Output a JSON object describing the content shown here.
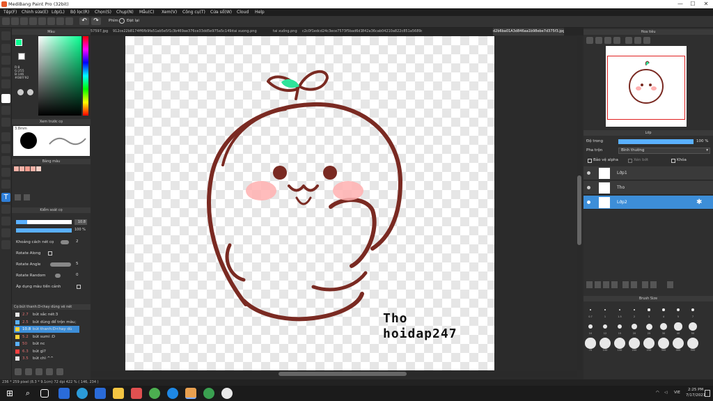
{
  "window": {
    "title": "MediBang Paint Pro (32bit)",
    "minimize": "—",
    "maximize": "☐",
    "close": "✕"
  },
  "menu": [
    "Tệp(F)",
    "Chỉnh sửa(E)",
    "Lớp(L)",
    "Bộ lọc(R)",
    "Chọn(S)",
    "Chụp(N)",
    "Mẫu(C)",
    "Xem(V)",
    "Công cụ(T)",
    "Cửa sổ(W)",
    "Cloud",
    "Help"
  ],
  "toolbar": {
    "keys_label": "Phím",
    "reset_label": "Đặt lại"
  },
  "color_panel": {
    "title": "Màu",
    "r": "R:8",
    "g": "G:255",
    "b": "B:146",
    "hex": "#08FF92"
  },
  "preview_panel": {
    "title": "Xem trước cọ",
    "size": "3.8mm"
  },
  "palette_panel": {
    "title": "Bảng màu",
    "colors": [
      "#f7b3a8",
      "#f7b3a8",
      "#f59c8e",
      "#f7b3a8",
      "#f9d0c6"
    ]
  },
  "brush_ctrl": {
    "title": "Kiểm soát cọ",
    "size_value": "10.8",
    "opacity_value": "100 %",
    "rows": [
      {
        "label": "Khoảng cách nét cọ",
        "value": "2"
      },
      {
        "label": "Rotate Along",
        "value": ""
      },
      {
        "label": "Rotate Angle",
        "value": "5"
      },
      {
        "label": "Rotate Random",
        "value": "0"
      },
      {
        "label": "Áp dụng màu tiền cảnh",
        "value": ""
      }
    ]
  },
  "brush_list": {
    "title": "Cọ:bút thanh:D<hay dùng vẽ nét",
    "items": [
      {
        "color": "#e8e8e8",
        "size": "2.7",
        "name": "bút sắc nét:3"
      },
      {
        "color": "#5ab0ff",
        "size": "2.5",
        "name": "bút dùng để trộn màu;"
      },
      {
        "color": "#ffd23a",
        "size": "10.8",
        "name": "bút thanh:D<hay dù"
      },
      {
        "color": "#ffd23a",
        "size": "5.2",
        "name": "bút sumi :D"
      },
      {
        "color": "#5ab0ff",
        "size": "50",
        "name": "bút nc"
      },
      {
        "color": "#ff4040",
        "size": "6.3",
        "name": "bút gì?"
      },
      {
        "color": "#e8e8e8",
        "size": "3.5",
        "name": "bút chì ^^"
      }
    ]
  },
  "tabs": [
    "57597.jpg",
    "912ce22b8174ff6fb9fa51ab5e5f1c3d.jpg",
    "3b469ae376ce33dd5e975a5c149ce29d.jpg",
    "tai xuong.png",
    "tai xuống.png",
    "c2c0f1edcd24c3ece7573f5bad6d180d.jpg",
    "842a36cab04210a822c851a5689d738.jpg",
    "d2b6ba01A3d846aa1b98ebe7d375f3.jpg"
  ],
  "artwork": {
    "watermark_line1": "Tho",
    "watermark_line2": "hoidap247"
  },
  "navigator": {
    "title": "Hoa tiêu"
  },
  "layer_panel": {
    "title": "Lớp",
    "opacity_label": "Độ trong",
    "opacity_value": "100 %",
    "blend_label": "Pha trộn",
    "blend_value": "Bình thường",
    "protect_alpha": "Bảo vệ alpha",
    "clipping": "Xén bớt",
    "lock": "Khóa",
    "layers": [
      {
        "name": "Lớp1",
        "selected": false
      },
      {
        "name": "Tho",
        "selected": false
      },
      {
        "name": "Lớp2",
        "selected": true
      }
    ]
  },
  "brush_size_panel": {
    "title": "Brush Size",
    "sizes": [
      "0.7",
      "1",
      "1.5",
      "2",
      "3",
      "4",
      "5",
      "7",
      "10",
      "12",
      "15",
      "20",
      "25",
      "30",
      "40",
      "50",
      "70",
      "100",
      "150",
      "200",
      "250",
      "300",
      "400",
      "500"
    ]
  },
  "status": {
    "text": "236 * 259 pixel  (8.3 * 9.1cm)  72 dpi  422 %  ( 146, 234 )"
  },
  "taskbar": {
    "time": "2:25 PM",
    "date": "7/17/2021",
    "lang": "VIE"
  }
}
